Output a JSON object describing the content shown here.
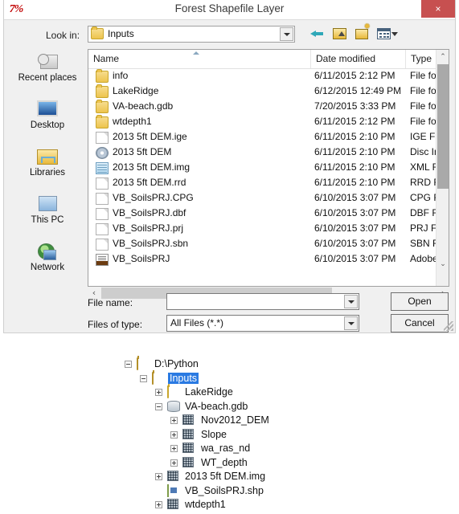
{
  "window": {
    "title": "Forest Shapefile Layer",
    "app_icon": "7%",
    "close_label": "×",
    "close_color": "#c75050"
  },
  "toolbar": {
    "lookin_label": "Look in:",
    "lookin_value": "Inputs",
    "lookin_icon": "folder-icon",
    "buttons": [
      {
        "name": "back-button",
        "icon": "back-arrow-icon"
      },
      {
        "name": "up-one-level-button",
        "icon": "up-folder-icon"
      },
      {
        "name": "create-new-folder-button",
        "icon": "new-folder-icon"
      },
      {
        "name": "views-button",
        "icon": "views-icon"
      }
    ]
  },
  "places": [
    {
      "label": "Recent places",
      "icon": "recent-places-icon"
    },
    {
      "label": "Desktop",
      "icon": "desktop-icon"
    },
    {
      "label": "Libraries",
      "icon": "libraries-icon"
    },
    {
      "label": "This PC",
      "icon": "this-pc-icon"
    },
    {
      "label": "Network",
      "icon": "network-icon"
    }
  ],
  "filelist": {
    "columns": [
      {
        "label": "Name",
        "sorted": "asc"
      },
      {
        "label": "Date modified",
        "sorted": ""
      },
      {
        "label": "Type",
        "sorted": ""
      }
    ],
    "rows": [
      {
        "name": "info",
        "date": "6/11/2015 2:12 PM",
        "type": "File fol",
        "icon": "folder-icon"
      },
      {
        "name": "LakeRidge",
        "date": "6/12/2015 12:49 PM",
        "type": "File fol",
        "icon": "folder-icon"
      },
      {
        "name": "VA-beach.gdb",
        "date": "7/20/2015 3:33 PM",
        "type": "File fol",
        "icon": "folder-icon"
      },
      {
        "name": "wtdepth1",
        "date": "6/11/2015 2:12 PM",
        "type": "File fol",
        "icon": "folder-icon"
      },
      {
        "name": "2013 5ft DEM.ige",
        "date": "6/11/2015 2:10 PM",
        "type": "IGE File",
        "icon": "document-icon"
      },
      {
        "name": "2013 5ft DEM",
        "date": "6/11/2015 2:10 PM",
        "type": "Disc Im",
        "icon": "disc-image-icon"
      },
      {
        "name": "2013 5ft DEM.img",
        "date": "6/11/2015 2:10 PM",
        "type": "XML Fi",
        "icon": "image-file-icon"
      },
      {
        "name": "2013 5ft DEM.rrd",
        "date": "6/11/2015 2:10 PM",
        "type": "RRD Fi",
        "icon": "document-icon"
      },
      {
        "name": "VB_SoilsPRJ.CPG",
        "date": "6/10/2015 3:07 PM",
        "type": "CPG Fi",
        "icon": "document-icon"
      },
      {
        "name": "VB_SoilsPRJ.dbf",
        "date": "6/10/2015 3:07 PM",
        "type": "DBF Fil",
        "icon": "document-icon"
      },
      {
        "name": "VB_SoilsPRJ.prj",
        "date": "6/10/2015 3:07 PM",
        "type": "PRJ Fil",
        "icon": "document-icon"
      },
      {
        "name": "VB_SoilsPRJ.sbn",
        "date": "6/10/2015 3:07 PM",
        "type": "SBN Fi",
        "icon": "document-icon"
      },
      {
        "name": "VB_SoilsPRJ",
        "date": "6/10/2015 3:07 PM",
        "type": "Adobe",
        "icon": "pdf-icon"
      }
    ]
  },
  "fields": {
    "filename_label": "File name:",
    "filename_value": "",
    "filetype_label": "Files of type:",
    "filetype_value": "All Files (*.*)"
  },
  "buttons": {
    "open_label": "Open",
    "cancel_label": "Cancel"
  },
  "tree": {
    "selected_color": "#2a7ae2",
    "nodes": [
      {
        "label": "D:\\Python",
        "depth": 0,
        "expander": "minus",
        "icon": "folder-open-icon",
        "selected": false
      },
      {
        "label": "Inputs",
        "depth": 1,
        "expander": "minus",
        "icon": "folder-open-icon",
        "selected": true
      },
      {
        "label": "LakeRidge",
        "depth": 2,
        "expander": "plus",
        "icon": "folder-icon",
        "selected": false
      },
      {
        "label": "VA-beach.gdb",
        "depth": 2,
        "expander": "minus",
        "icon": "geodatabase-icon",
        "selected": false
      },
      {
        "label": "Nov2012_DEM",
        "depth": 3,
        "expander": "plus",
        "icon": "raster-icon",
        "selected": false
      },
      {
        "label": "Slope",
        "depth": 3,
        "expander": "plus",
        "icon": "raster-icon",
        "selected": false
      },
      {
        "label": "wa_ras_nd",
        "depth": 3,
        "expander": "plus",
        "icon": "raster-icon",
        "selected": false
      },
      {
        "label": "WT_depth",
        "depth": 3,
        "expander": "plus",
        "icon": "raster-icon",
        "selected": false
      },
      {
        "label": "2013 5ft DEM.img",
        "depth": 2,
        "expander": "plus",
        "icon": "raster-icon",
        "selected": false
      },
      {
        "label": "VB_SoilsPRJ.shp",
        "depth": 2,
        "expander": "none",
        "icon": "shapefile-icon",
        "selected": false
      },
      {
        "label": "wtdepth1",
        "depth": 2,
        "expander": "plus",
        "icon": "raster-icon",
        "selected": false
      }
    ]
  },
  "scrollbars": {
    "vertical_up": "⌃",
    "vertical_down": "⌄",
    "horizontal_left": "‹",
    "horizontal_right": "›"
  }
}
